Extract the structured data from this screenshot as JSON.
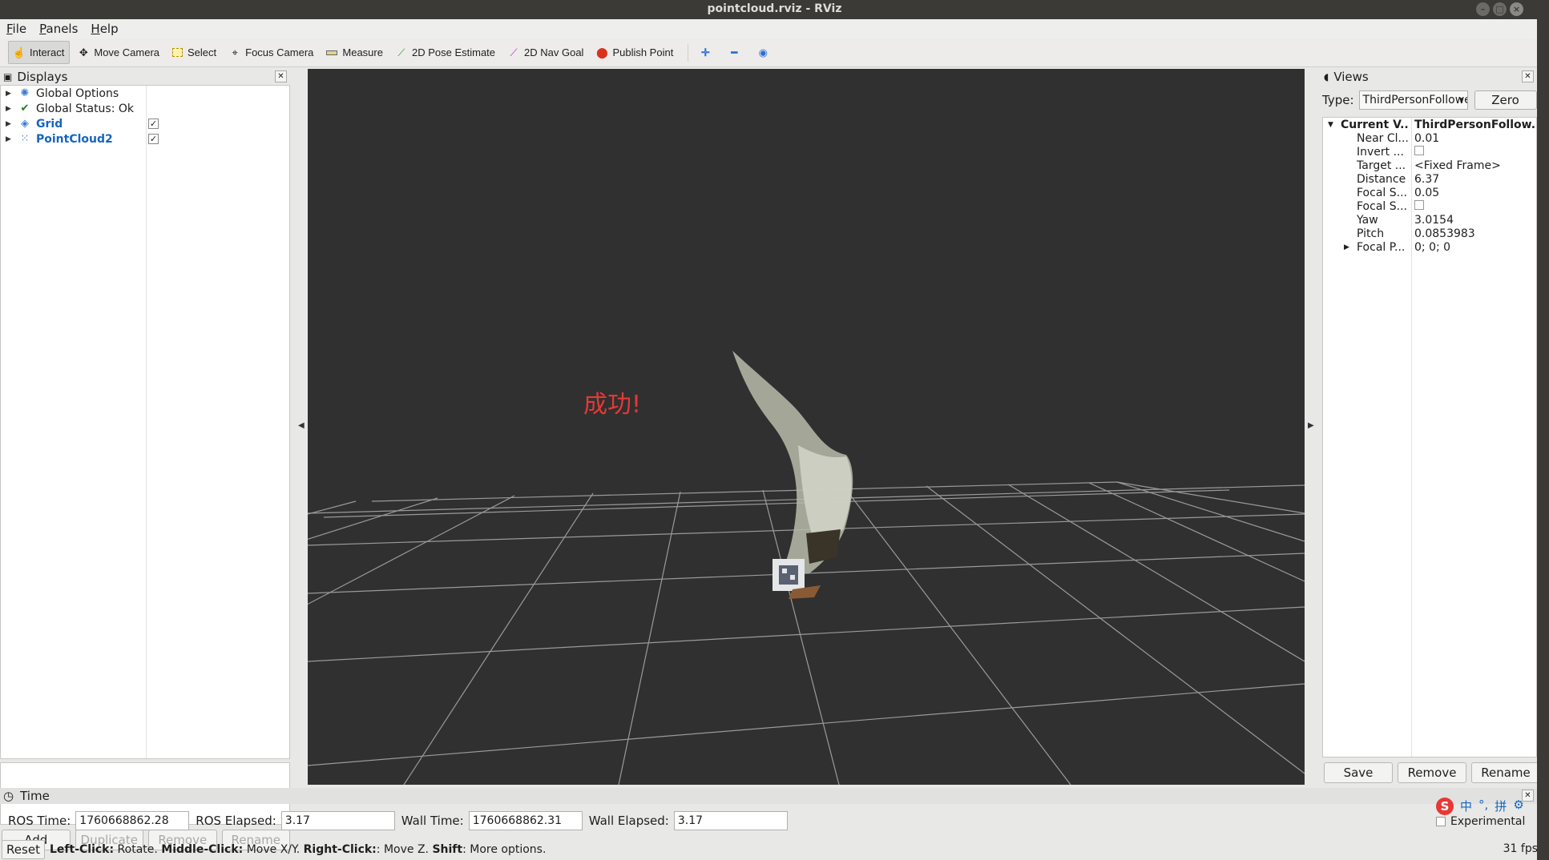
{
  "window": {
    "title": "pointcloud.rviz - RViz"
  },
  "menu": [
    {
      "label": "File",
      "ul": "F",
      "rest": "ile"
    },
    {
      "label": "Panels",
      "ul": "P",
      "rest": "anels"
    },
    {
      "label": "Help",
      "ul": "H",
      "rest": "elp"
    }
  ],
  "toolbar": {
    "interact": "Interact",
    "move_camera": "Move Camera",
    "select": "Select",
    "focus_camera": "Focus Camera",
    "measure": "Measure",
    "pose_estimate": "2D Pose Estimate",
    "nav_goal": "2D Nav Goal",
    "publish_point": "Publish Point"
  },
  "displays": {
    "title": "Displays",
    "items": [
      {
        "label": "Global Options",
        "icon": "gear-icon"
      },
      {
        "label": "Global Status: Ok",
        "icon": "check-icon"
      },
      {
        "label": "Grid",
        "icon": "grid-icon",
        "checked": true
      },
      {
        "label": "PointCloud2",
        "icon": "pointcloud-icon",
        "checked": true
      }
    ],
    "buttons": {
      "add": "Add",
      "duplicate": "Duplicate",
      "remove": "Remove",
      "rename": "Rename"
    }
  },
  "viewport": {
    "overlay_text": "成功!"
  },
  "views": {
    "title": "Views",
    "type_label": "Type:",
    "type_value": "ThirdPersonFollower",
    "zero": "Zero",
    "current_label": "Current V...",
    "current_value": "ThirdPersonFollow...",
    "props": [
      {
        "k": "Near Cl...",
        "v": "0.01"
      },
      {
        "k": "Invert ...",
        "v": ""
      },
      {
        "k": "Target ...",
        "v": "<Fixed Frame>"
      },
      {
        "k": "Distance",
        "v": "6.37"
      },
      {
        "k": "Focal S...",
        "v": "0.05"
      },
      {
        "k": "Focal S...",
        "v": ""
      },
      {
        "k": "Yaw",
        "v": "3.0154"
      },
      {
        "k": "Pitch",
        "v": "0.0853983"
      },
      {
        "k": "Focal P...",
        "v": "0; 0; 0"
      }
    ],
    "buttons": {
      "save": "Save",
      "remove": "Remove",
      "rename": "Rename"
    }
  },
  "time": {
    "title": "Time",
    "ros_time_label": "ROS Time:",
    "ros_time": "1760668862.28",
    "ros_elapsed_label": "ROS Elapsed:",
    "ros_elapsed": "3.17",
    "wall_time_label": "Wall Time:",
    "wall_time": "1760668862.31",
    "wall_elapsed_label": "Wall Elapsed:",
    "wall_elapsed": "3.17",
    "experimental": "Experimental"
  },
  "status": {
    "reset": "Reset",
    "hint_lc": "Left-Click:",
    "hint_lc_v": " Rotate. ",
    "hint_mc": "Middle-Click:",
    "hint_mc_v": " Move X/Y. ",
    "hint_rc": "Right-Click:",
    "hint_rc_v": ": Move Z. ",
    "hint_sh": "Shift",
    "hint_sh_v": ": More options.",
    "fps": "31 fps"
  },
  "ime": {
    "lang": "中",
    "punct": "°,",
    "pinyin": "拼"
  },
  "colors": {
    "viewport_bg": "#303030",
    "grid": "#a0a0a0",
    "overlay": "#e53935",
    "link": "#1565c0"
  }
}
